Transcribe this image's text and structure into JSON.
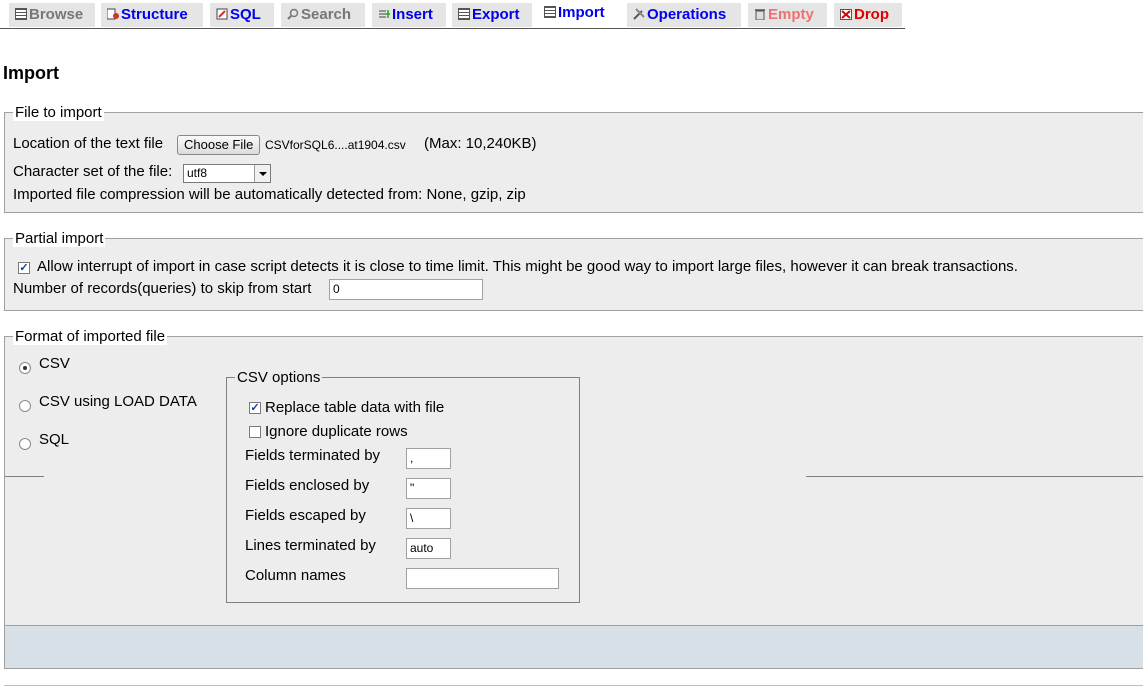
{
  "tabs": [
    {
      "label": "Browse",
      "icon": "browse-icon"
    },
    {
      "label": "Structure",
      "icon": "structure-icon"
    },
    {
      "label": "SQL",
      "icon": "sql-icon"
    },
    {
      "label": "Search",
      "icon": "search-icon"
    },
    {
      "label": "Insert",
      "icon": "insert-icon"
    },
    {
      "label": "Export",
      "icon": "export-icon"
    },
    {
      "label": "Import",
      "icon": "import-icon",
      "active": true
    },
    {
      "label": "Operations",
      "icon": "operations-icon"
    },
    {
      "label": "Empty",
      "icon": "empty-icon"
    },
    {
      "label": "Drop",
      "icon": "drop-icon"
    }
  ],
  "page": {
    "title": "Import"
  },
  "file_to_import": {
    "legend": "File to import",
    "location_label": "Location of the text file",
    "choose_button": "Choose File",
    "file_name": "CSVforSQL6....at1904.csv",
    "max_size": "(Max: 10,240KB)",
    "charset_label": "Character set of the file:",
    "charset_value": "utf8",
    "compression_note": "Imported file compression will be automatically detected from: None, gzip, zip"
  },
  "partial_import": {
    "legend": "Partial import",
    "allow_interrupt_label": "Allow interrupt of import in case script detects it is close to time limit. This might be good way to import large files, however it can break transactions.",
    "allow_interrupt_checked": true,
    "skip_label": "Number of records(queries) to skip from start",
    "skip_value": "0"
  },
  "format": {
    "legend": "Format of imported file",
    "options": [
      {
        "label": "CSV",
        "selected": true
      },
      {
        "label": "CSV using LOAD DATA",
        "selected": false
      },
      {
        "label": "SQL",
        "selected": false
      }
    ],
    "csv_options": {
      "legend": "CSV options",
      "replace_label": "Replace table data with file",
      "replace_checked": true,
      "ignore_label": "Ignore duplicate rows",
      "ignore_checked": false,
      "fields_terminated_label": "Fields terminated by",
      "fields_terminated_value": ",",
      "fields_enclosed_label": "Fields enclosed by",
      "fields_enclosed_value": "\"",
      "fields_escaped_label": "Fields escaped by",
      "fields_escaped_value": "\\",
      "lines_terminated_label": "Lines terminated by",
      "lines_terminated_value": "auto",
      "column_names_label": "Column names",
      "column_names_value": ""
    }
  },
  "colors": {
    "tab_text": "#0000ee",
    "tab_bg": "#e5e5e5",
    "panel_bg": "#ededed",
    "footer_bar": "#d7e0e6",
    "empty_tab": "#f07070",
    "drop_tab": "#e00000"
  }
}
